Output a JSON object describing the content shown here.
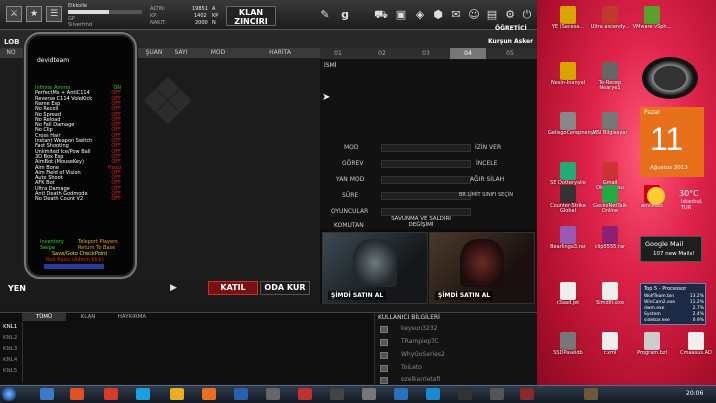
{
  "colors": {
    "cheat_on": "#34d02a",
    "cheat_off": "#e02020",
    "cheat_label": "#ffffff",
    "desktop_bg": "#e0244c",
    "calendar": "#e8701a"
  },
  "game": {
    "player": {
      "name": "Eikkolle",
      "nick": "Silverfrhd",
      "xp_fraction": 0.55
    },
    "stats": [
      {
        "label": "ALTIN:",
        "value": "19851",
        "unit": "A"
      },
      {
        "label": "KP:",
        "value": "1402",
        "unit": "KP"
      },
      {
        "label": "NAKIT:",
        "value": "2000",
        "unit": "N"
      }
    ],
    "clan_button": "KLAN ZINCIRI",
    "tutorial_label": "ÖĞRETİCİ",
    "rank": "Kurşun Asker",
    "lobby_label": "LOB",
    "left_tabs": [
      "NO",
      "ŞUAN",
      "SAYI",
      "MOD",
      "HARİTA"
    ],
    "room_tabs": [
      "01",
      "02",
      "03",
      "04",
      "05"
    ],
    "active_room_tab": "04",
    "room_name_label": "İSMİ",
    "room_fields": [
      {
        "label": "MOD",
        "option": "İZİN VER"
      },
      {
        "label": "GÖREV",
        "option": "İNCELE"
      },
      {
        "label": "YAN MOD",
        "option": "AĞIR SİLAH"
      },
      {
        "label": "SÜRE",
        "option": "BR LİMİT SINIFI SEÇİN"
      },
      {
        "label": "OYUNCULAR",
        "option": ""
      },
      {
        "label": "KOMUTAN",
        "option": ""
      }
    ],
    "mode_label": "SAVUNMA VE SALDIRI DEĞİŞİMİ",
    "buy_now": [
      "ŞİMDİ SATIN AL",
      "ŞİMDİ SATIN AL"
    ],
    "new_label": "YEN",
    "katil_button": "KATIL",
    "oda_kur_button": "ODA KUR",
    "chat_tabs": [
      "TÜMÜ",
      "KLAN",
      "HAYKIRMA"
    ],
    "channels": [
      "KNL1",
      "KNL2",
      "KNL3",
      "KNL4",
      "KNL5"
    ],
    "user_info_title": "KULLANICI BİLGİLERİ",
    "users": [
      "keysun3232",
      "TRampiepTC",
      "WhyGoSeries2",
      "ToiLeto",
      "ozelkarrietafi"
    ]
  },
  "cheat": {
    "title": "devidteam",
    "items": [
      {
        "label": "Infinite Ammo",
        "value": "ON"
      },
      {
        "label": "PerfectMs + AntiC114",
        "value": "OFF"
      },
      {
        "label": "Reverse C114 VoleKick",
        "value": "OFF"
      },
      {
        "label": "Name Esp",
        "value": "OFF"
      },
      {
        "label": "No Recoil",
        "value": "OFF"
      },
      {
        "label": "No Spread",
        "value": "OFF"
      },
      {
        "label": "No Reload",
        "value": "OFF"
      },
      {
        "label": "No Fall Damage",
        "value": "OFF"
      },
      {
        "label": "No Clip",
        "value": "OFF"
      },
      {
        "label": "Cross Hair",
        "value": "OFF"
      },
      {
        "label": "Instant Weapon Switch",
        "value": "OFF"
      },
      {
        "label": "Fast Shooting",
        "value": "OFF"
      },
      {
        "label": "Unlimited Ice/Pow Ball",
        "value": "OFF"
      },
      {
        "label": "3D Box Esp",
        "value": "OFF"
      },
      {
        "label": "AimBot (MouseKey)",
        "value": "OFF"
      },
      {
        "label": "Aim Bone",
        "value": "Head"
      },
      {
        "label": "Aim Field of Vision",
        "value": "OFF"
      },
      {
        "label": "Auto Shoot",
        "value": "OFF"
      },
      {
        "label": "AFK Bot",
        "value": "OFF"
      },
      {
        "label": "Ultra Damage",
        "value": "OFF"
      },
      {
        "label": "Anti Death Godmode",
        "value": "OFF"
      },
      {
        "label": "No Death Count V2",
        "value": "OFF"
      }
    ],
    "footer": [
      {
        "label": "Inventory",
        "color": "#30d030"
      },
      {
        "label": "Teleport Players",
        "color": "#e8a020"
      },
      {
        "label": "Swipe",
        "color": "#30d030"
      },
      {
        "label": "Return To Base",
        "color": "#e8a020"
      },
      {
        "label": "Save/Goto CheckPoint",
        "color": "#e8e020"
      },
      {
        "label": "Red Basic (Admin Kick)",
        "color": "#e02020"
      }
    ]
  },
  "desktop": {
    "icons": [
      {
        "label": "YE (Sacesa...",
        "color": "#d9a300"
      },
      {
        "label": "Ultra ascendy...",
        "color": "#c0392b"
      },
      {
        "label": "VMware vSph...",
        "color": "#5aa02c"
      },
      {
        "label": "Nesin-Inanyel",
        "color": "#d9a300"
      },
      {
        "label": "Te-Recep Nearye1",
        "color": "#666"
      },
      {
        "label": "GelisgoCerepnenyu",
        "color": "#888"
      },
      {
        "label": "MSI Bilgisayar",
        "color": "#777"
      },
      {
        "label": "SE Dotteryalle",
        "color": "#2a7"
      },
      {
        "label": "Gmail Okuyucusu",
        "color": "#c33"
      },
      {
        "label": "Counter-Strike Global",
        "color": "#333"
      },
      {
        "label": "GeckoNetTalk Online",
        "color": "#2a4"
      },
      {
        "label": "anviliuss",
        "color": "#c00"
      },
      {
        "label": "Bearlinga3.rar",
        "color": "#9b59b6"
      },
      {
        "label": "clip5555.rar",
        "color": "#8e2070"
      },
      {
        "label": "r3aad.jet",
        "color": "#eee"
      },
      {
        "label": "Simdilt.exe",
        "color": "#eee"
      },
      {
        "label": "r.xml",
        "color": "#eee"
      },
      {
        "label": "SSDPaseldb",
        "color": "#777"
      },
      {
        "label": "Program.bzl",
        "color": "#ccc"
      },
      {
        "label": "Cmaasus.AD",
        "color": "#eee"
      }
    ],
    "calendar": {
      "day_name": "Pazar",
      "day": "11",
      "month_year": "Ağustos 2013"
    },
    "weather": {
      "temp": "30°C",
      "location": "Istanbul, TUR"
    },
    "gmail": {
      "title": "Google Mail",
      "new_mails": "107 new Mails!"
    },
    "top_processes": {
      "title": "Top 5 - Processor",
      "rows": [
        {
          "name": "WolfTeam.bin",
          "value": "13.2%"
        },
        {
          "name": "WinCam2.exe",
          "value": "11.2%"
        },
        {
          "name": "dwm.exe",
          "value": "2.7%"
        },
        {
          "name": "System",
          "value": "2.4%"
        },
        {
          "name": "sidebar.exe",
          "value": "0.9%"
        }
      ]
    }
  },
  "taskbar": {
    "clock": "20:06"
  }
}
